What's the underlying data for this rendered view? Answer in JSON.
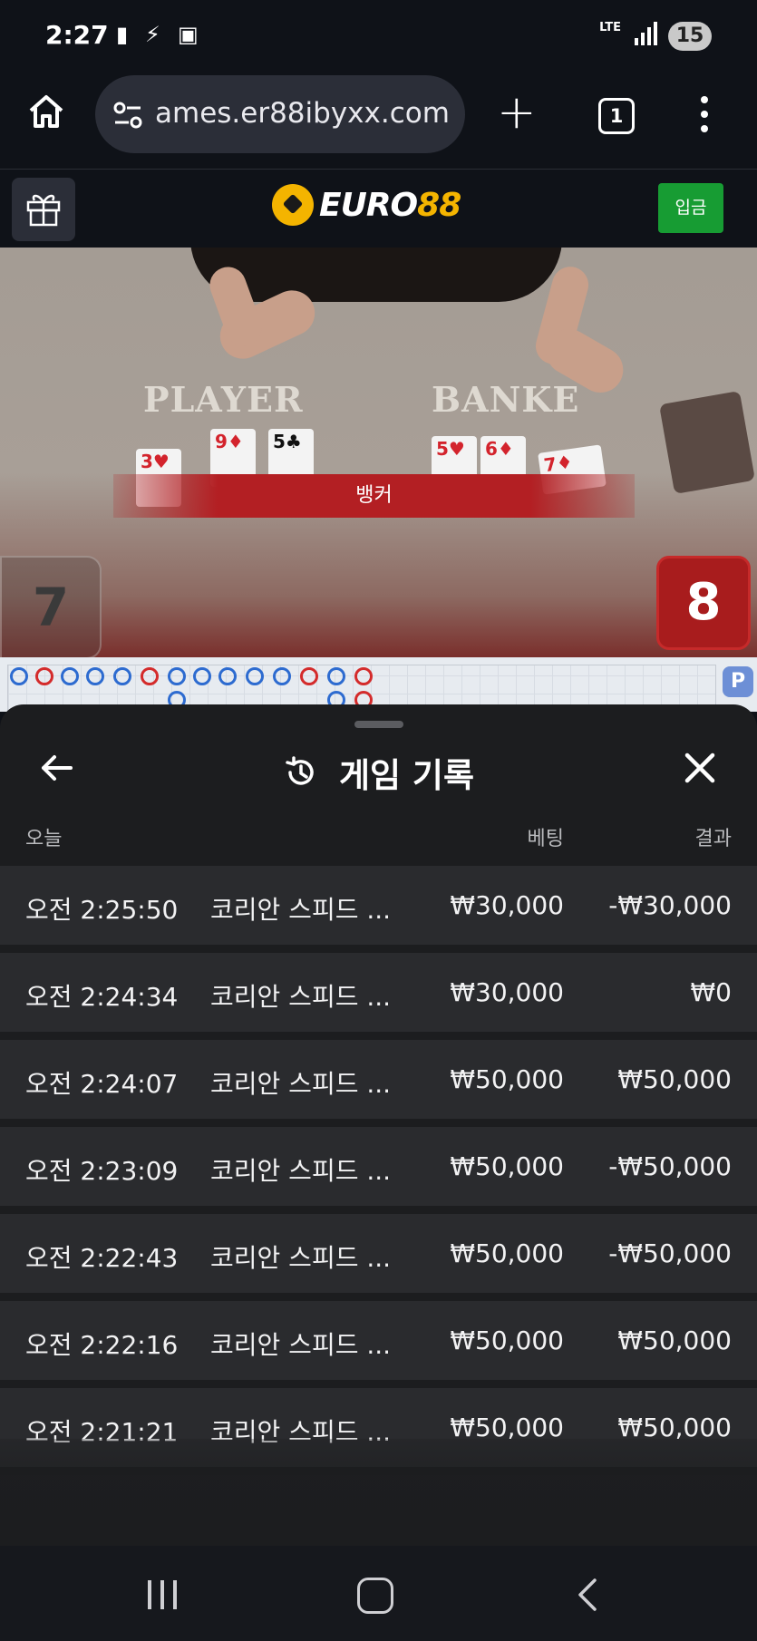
{
  "status_bar": {
    "time": "2:27",
    "network": "LTE",
    "battery": "15"
  },
  "browser": {
    "url": "ames.er88ibyxx.com",
    "tab_count": "1"
  },
  "site": {
    "logo_word_a": "EURO",
    "logo_word_b": "88",
    "deposit_label": "입금"
  },
  "game_view": {
    "player_label": "PLAYER",
    "banker_label": "BANKE",
    "result_banner": "뱅커",
    "player_score": "7",
    "banker_score": "8",
    "player_cards": [
      {
        "rank": "3",
        "suit": "♥",
        "color": "red"
      },
      {
        "rank": "9",
        "suit": "♦",
        "color": "red"
      },
      {
        "rank": "5",
        "suit": "♣",
        "color": "black"
      }
    ],
    "banker_cards": [
      {
        "rank": "5",
        "suit": "♥",
        "color": "red"
      },
      {
        "rank": "6",
        "suit": "♦",
        "color": "red"
      },
      {
        "rank": "7",
        "suit": "♦",
        "color": "red"
      }
    ],
    "roadmap_badge": "P"
  },
  "history_sheet": {
    "title": "게임 기록",
    "columns": {
      "date": "오늘",
      "bet": "베팅",
      "result": "결과"
    },
    "rows": [
      {
        "time": "오전 2:25:50",
        "game": "코리안 스피드 ...",
        "bet": "₩30,000",
        "result": "-₩30,000"
      },
      {
        "time": "오전 2:24:34",
        "game": "코리안 스피드 ...",
        "bet": "₩30,000",
        "result": "₩0"
      },
      {
        "time": "오전 2:24:07",
        "game": "코리안 스피드 ...",
        "bet": "₩50,000",
        "result": "₩50,000"
      },
      {
        "time": "오전 2:23:09",
        "game": "코리안 스피드 ...",
        "bet": "₩50,000",
        "result": "-₩50,000"
      },
      {
        "time": "오전 2:22:43",
        "game": "코리안 스피드 ...",
        "bet": "₩50,000",
        "result": "-₩50,000"
      },
      {
        "time": "오전 2:22:16",
        "game": "코리안 스피드 ...",
        "bet": "₩50,000",
        "result": "₩50,000"
      },
      {
        "time": "오전 2:21:21",
        "game": "코리안 스피드 ...",
        "bet": "₩50,000",
        "result": "₩50,000"
      }
    ]
  },
  "colors": {
    "accent_green": "#179c33",
    "banker_red": "#b31f23",
    "player_blue": "#2d6bd0",
    "logo_gold": "#f4b400"
  }
}
